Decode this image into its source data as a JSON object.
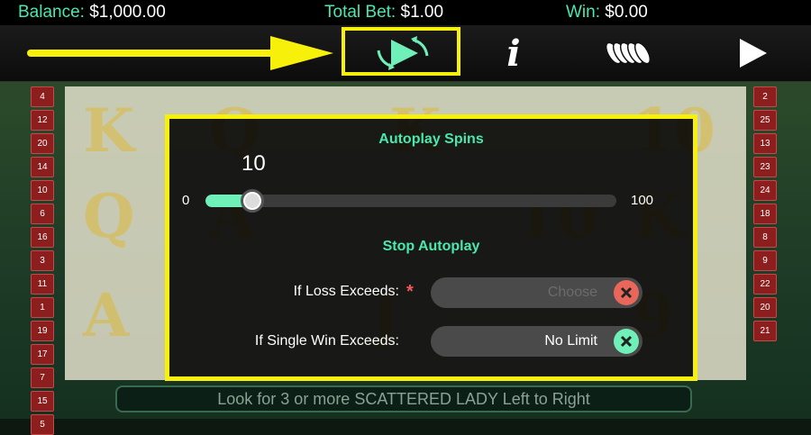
{
  "status": {
    "balance_label": "Balance:",
    "balance_value": "$1,000.00",
    "bet_label": "Total Bet:",
    "bet_value": "$1.00",
    "win_label": "Win:",
    "win_value": "$0.00"
  },
  "toolbar": {
    "icons": [
      "back-arrow-icon",
      "autoplay-icon",
      "info-icon",
      "coin-stack-icon",
      "play-icon"
    ],
    "info_glyph": "i",
    "accent": "#49e8ae",
    "highlight_color": "#f6f00a"
  },
  "paytable": {
    "left": [
      "4",
      "12",
      "20",
      "14",
      "10",
      "6",
      "16",
      "3",
      "11",
      "1",
      "19",
      "17",
      "7",
      "15",
      "5"
    ],
    "right": [
      "2",
      "25",
      "13",
      "23",
      "24",
      "18",
      "8",
      "9",
      "22",
      "20",
      "21"
    ]
  },
  "reels": {
    "symbols": [
      "K",
      "Q",
      "K",
      "10",
      "Q",
      "A",
      "10",
      "K",
      "A",
      "J",
      "9"
    ]
  },
  "message": "Look for 3 or more SCATTERED LADY Left to Right",
  "autoplay": {
    "spins_title": "Autoplay Spins",
    "spins_value": "10",
    "min": "0",
    "max": "100",
    "level": 0.1,
    "stop_title": "Stop Autoplay",
    "loss_label": "If Loss Exceeds:",
    "loss_required": "*",
    "loss_placeholder": "Choose",
    "win_label": "If Single Win Exceeds:",
    "win_value": "No Limit"
  }
}
